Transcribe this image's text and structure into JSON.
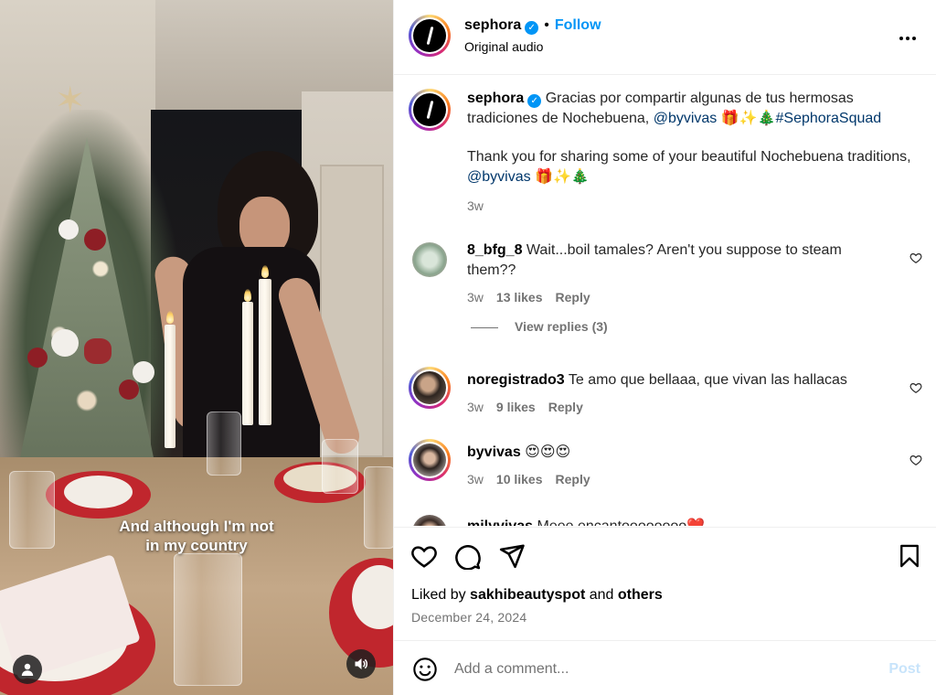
{
  "media": {
    "caption_line1": "And although I'm not",
    "caption_line2": "in my country"
  },
  "header": {
    "username": "sephora",
    "verified_icon": "verified-badge",
    "separator": "•",
    "follow_label": "Follow",
    "audio_label": "Original audio",
    "more_icon": "more-options"
  },
  "post_caption": {
    "username": "sephora",
    "text_es": "Gracias por compartir algunas de tus hermosas tradiciones de Nochebuena, ",
    "mention_es": "@byvivas",
    "emoji_es": " 🎁✨🎄",
    "hashtag": "#SephoraSquad",
    "text_en": "Thank you for sharing some of your beautiful Nochebuena traditions, ",
    "mention_en": "@byvivas",
    "emoji_en": " 🎁✨🎄",
    "age": "3w"
  },
  "comments": [
    {
      "username": "8_bfg_8",
      "text": " Wait...boil tamales? Aren't you suppose to steam them??",
      "age": "3w",
      "likes": "13 likes",
      "reply": "Reply",
      "view_replies": "View replies (3)"
    },
    {
      "username": "noregistrado3",
      "text": " Te amo que bellaaa, que vivan las hallacas",
      "age": "3w",
      "likes": "9 likes",
      "reply": "Reply"
    },
    {
      "username": "byvivas",
      "text": " 😍😍😍",
      "age": "3w",
      "likes": "10 likes",
      "reply": "Reply"
    },
    {
      "username": "milyvivas",
      "text": " Meee encantoooooooo❤️"
    }
  ],
  "actions": {
    "liked_by_prefix": "Liked by ",
    "liked_by_user": "sakhibeautyspot",
    "liked_by_mid": " and ",
    "liked_by_others": "others",
    "date": "December 24, 2024"
  },
  "add_comment": {
    "placeholder": "Add a comment...",
    "post_label": "Post"
  },
  "colors": {
    "accent": "#0095f6",
    "link": "#00376b",
    "muted": "#737373"
  }
}
